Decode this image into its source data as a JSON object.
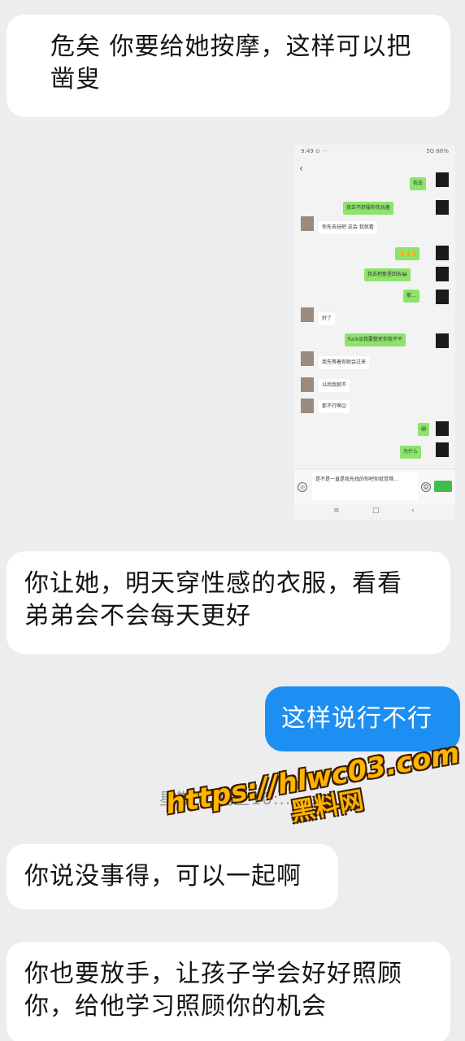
{
  "messages": [
    {
      "id": "msg1",
      "side": "in",
      "lines": [
        "危矣 你要给她按摩，这样可以把",
        "凿叟"
      ]
    },
    {
      "id": "msg2",
      "side": "in",
      "lines": [
        "你让她，明天穿性感的衣服，看看",
        "弟弟会不会每天更好"
      ]
    },
    {
      "id": "msg3",
      "side": "out",
      "lines": [
        "这样说行不行"
      ]
    },
    {
      "id": "msg4",
      "side": "in",
      "lines": [
        "你说没事得，可以一起啊"
      ]
    },
    {
      "id": "msg5",
      "side": "in",
      "lines": [
        "你也要放手，让孩子学会好好照顾",
        "你，给他学习照顾你的机会"
      ]
    }
  ],
  "timestamp": "星期一 晚上10:...",
  "watermark": {
    "url": "https://hlwc03.com",
    "name": "黑料网"
  },
  "embedded_screenshot": {
    "status_left": "9:49 ⊙ ···",
    "status_right": "5G 86%",
    "back": "‹",
    "bubbles": [
      {
        "side": "g",
        "text": "我去"
      },
      {
        "side": "g",
        "text": "我去不舒服你先玩着"
      },
      {
        "side": "w",
        "text": "你先去玩吧 这会 我就看"
      },
      {
        "side": "g",
        "text": "👍👍👍"
      },
      {
        "side": "g",
        "text": "我去把那里回去😂"
      },
      {
        "side": "g",
        "text": "那…"
      },
      {
        "side": "w",
        "text": "好了"
      },
      {
        "side": "g",
        "text": "fuck😡我要整死你我不干"
      },
      {
        "side": "w",
        "text": "我先等着你就会过来"
      },
      {
        "side": "w",
        "text": "以后我就不"
      },
      {
        "side": "w",
        "text": "那不行啊😊"
      },
      {
        "side": "g",
        "text": "😱"
      },
      {
        "side": "g",
        "text": "为什么"
      }
    ],
    "input_text": "是不是一直是我先找的你吧你就觉得...",
    "nav": [
      "≡",
      "□",
      "‹"
    ]
  },
  "colors": {
    "background": "#ededf0",
    "incoming": "#ffffff",
    "outgoing": "#1e8ff2",
    "watermark": "#ffb400"
  }
}
